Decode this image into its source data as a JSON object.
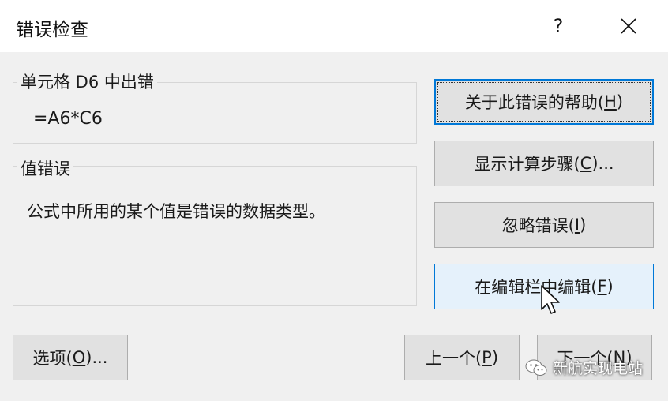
{
  "dialog": {
    "title": "错误检查",
    "help_glyph": "?"
  },
  "cell_group": {
    "label": "单元格 D6 中出错",
    "formula": "=A6*C6"
  },
  "error_group": {
    "label": "值错误",
    "description": "公式中所用的某个值是错误的数据类型。"
  },
  "buttons": {
    "help": {
      "text": "关于此错误的帮助(",
      "key": "H",
      "end": ")"
    },
    "steps": {
      "text": "显示计算步骤(",
      "key": "C",
      "end": ")..."
    },
    "ignore": {
      "text": "忽略错误(",
      "key": "I",
      "end": ")"
    },
    "edit": {
      "text": "在编辑栏中编辑(",
      "key": "F",
      "end": ")"
    },
    "options": {
      "text": "选项(",
      "key": "O",
      "end": ")..."
    },
    "prev": {
      "text": "上一个(",
      "key": "P",
      "end": ")"
    },
    "next": {
      "text": "下一个(",
      "key": "N",
      "end": ")"
    }
  },
  "watermark": {
    "text": "新航实现电站"
  },
  "colors": {
    "focus_border": "#0078d7",
    "hover_fill": "#e5f1fb",
    "button_fill": "#e1e1e1"
  }
}
